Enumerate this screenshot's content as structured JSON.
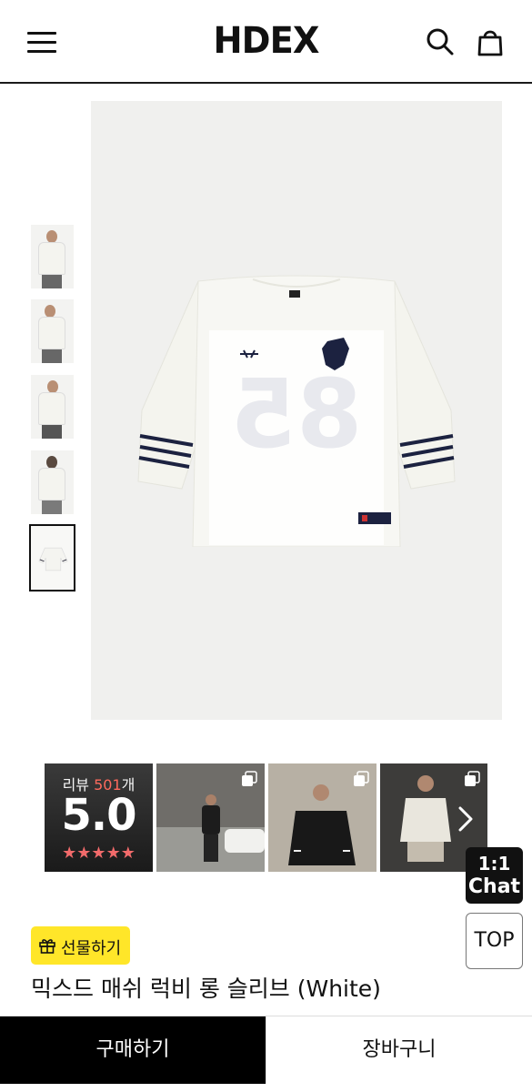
{
  "header": {
    "logo": "HDEX",
    "icons": {
      "menu": "menu-icon",
      "search": "search-icon",
      "cart": "shopping-bag-icon"
    }
  },
  "gallery": {
    "thumbnail_count": 5,
    "active_thumbnail": 5,
    "main_image": {
      "jersey_number": "85"
    }
  },
  "reviews": {
    "label": "리뷰",
    "count": "501",
    "count_suffix": "개",
    "score": "5.0",
    "stars": "★★★★★"
  },
  "floating": {
    "chat_line1": "1:1",
    "chat_line2": "Chat",
    "top_label": "TOP"
  },
  "product": {
    "gift_label": "선물하기",
    "title": "믹스드 매쉬 럭비 롱 슬리브 (White)"
  },
  "actions": {
    "buy_label": "구매하기",
    "cart_label": "장바구니"
  },
  "colors": {
    "accent_yellow": "#ffe629",
    "star_red": "#f26b6b",
    "review_count_red": "#ff6a5d",
    "primary_black": "#000000"
  }
}
